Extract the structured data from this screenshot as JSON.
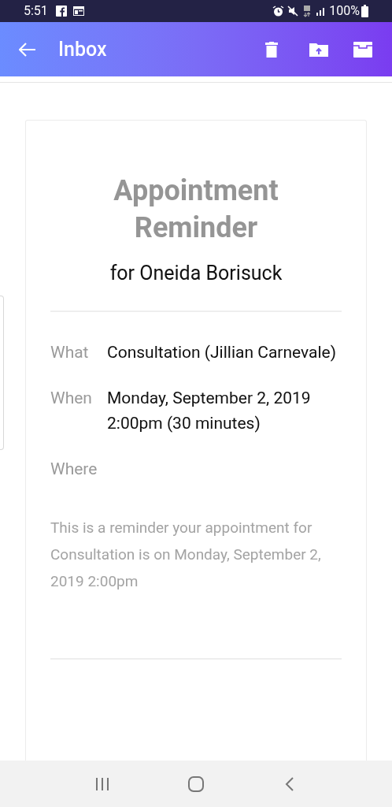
{
  "status_bar": {
    "time": "5:51",
    "battery": "100%"
  },
  "app_bar": {
    "title": "Inbox"
  },
  "email": {
    "title": "Appointment Reminder",
    "subtitle": "for Oneida Borisuck",
    "details": [
      {
        "label": "What",
        "value": "Consultation (Jillian Carnevale)"
      },
      {
        "label": "When",
        "value": "Monday, September 2, 2019 2:00pm (30 minutes)"
      },
      {
        "label": "Where"
      }
    ],
    "message": "This is a reminder your appointment for Consultation is on Monday, September 2, 2019 2:00pm"
  }
}
